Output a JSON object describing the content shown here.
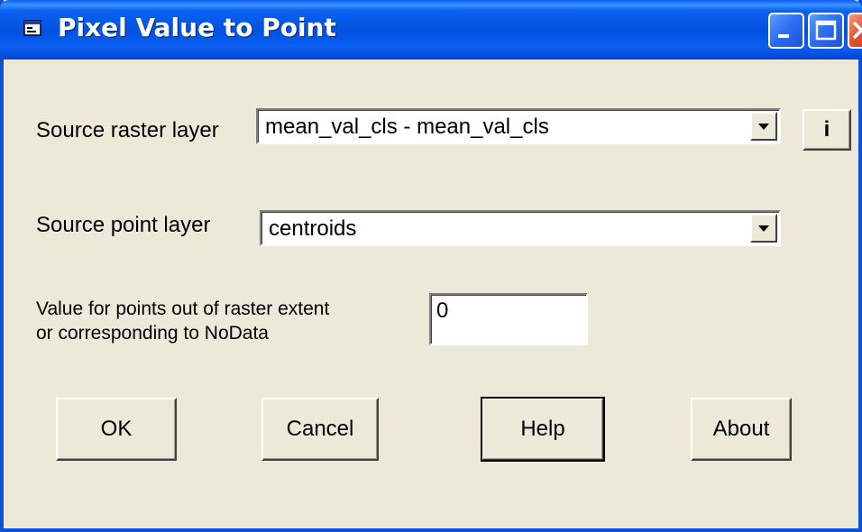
{
  "window": {
    "title": "Pixel Value to Point"
  },
  "fields": {
    "raster_label": "Source raster layer",
    "raster_value": "mean_val_cls - mean_val_cls",
    "info_button_label": "i",
    "point_label": "Source point layer",
    "point_value": "centroids",
    "nodata_label_line1": "Value for points out of raster extent",
    "nodata_label_line2": "or corresponding to NoData",
    "nodata_value": "0"
  },
  "buttons": {
    "ok": "OK",
    "cancel": "Cancel",
    "help": "Help",
    "about": "About"
  },
  "colors": {
    "titlebar": "#0352e0",
    "face": "#ece9d8",
    "close": "#e35532"
  },
  "icons": [
    "window-app-icon",
    "minimize-icon",
    "maximize-icon",
    "close-icon",
    "dropdown-arrow-icon"
  ]
}
